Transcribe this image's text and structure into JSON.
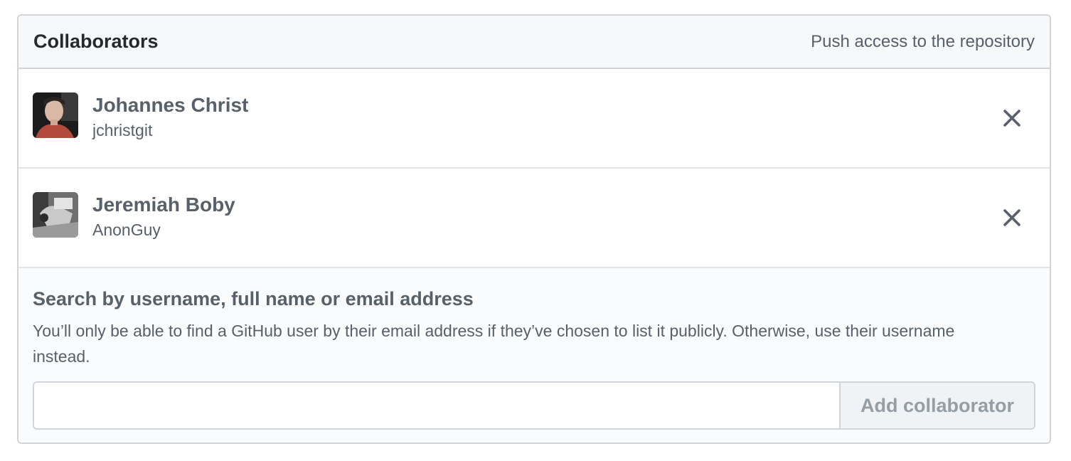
{
  "header": {
    "title": "Collaborators",
    "subtitle": "Push access to the repository"
  },
  "collaborators": [
    {
      "name": "Johannes Christ",
      "login": "jchristgit",
      "avatar_icon": "user-avatar-photo",
      "remove_icon": "close-icon"
    },
    {
      "name": "Jeremiah Boby",
      "login": "AnonGuy",
      "avatar_icon": "user-avatar-photo",
      "remove_icon": "close-icon"
    }
  ],
  "add": {
    "title": "Search by username, full name or email address",
    "note": "You’ll only be able to find a GitHub user by their email address if they’ve chosen to list it publicly. Otherwise, use their username instead.",
    "input_value": "",
    "input_placeholder": "",
    "button_label": "Add collaborator"
  },
  "colors": {
    "header_bg": "#f6f8fa",
    "border": "#d1d5da",
    "muted_text": "#586069",
    "button_bg": "#eff3f6",
    "button_text": "#959da5"
  }
}
